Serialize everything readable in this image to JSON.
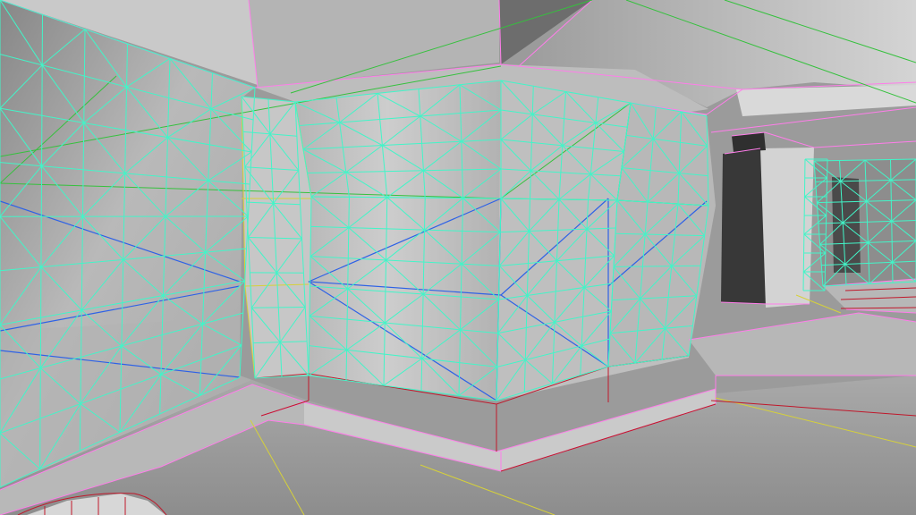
{
  "viewport": {
    "mode": "wireframe-overlay",
    "text": []
  },
  "palette": {
    "geometry_base": "#8f8f8f",
    "surface_light": "#c9c9c9",
    "surface_mid": "#a9a9a9",
    "surface_dark": "#6f6f6f",
    "shadow": "#303030",
    "wire_cyan": "#42f5c8",
    "wire_pink": "#ff7dea",
    "wire_green": "#35c13d",
    "wire_blue": "#2e62e6",
    "wire_red": "#c0182b",
    "wire_yellow": "#d6d13a"
  }
}
